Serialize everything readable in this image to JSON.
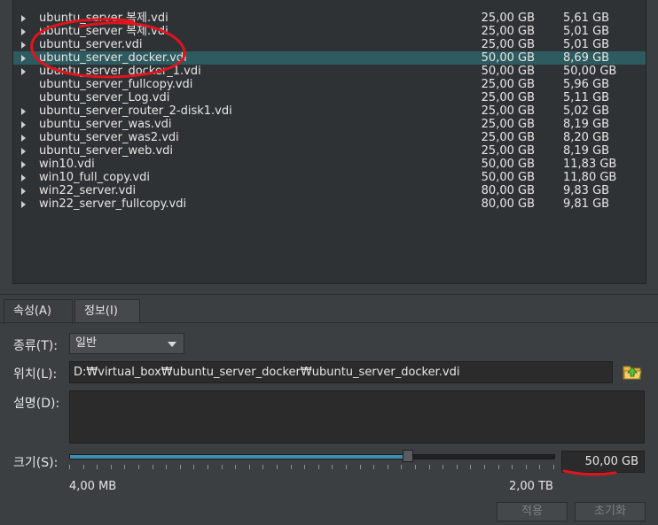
{
  "disk_list": {
    "rows": [
      {
        "name": "ubuntu_server 복제.vdi",
        "has_children": true,
        "selected": false,
        "virtual_size": "25,00 GB",
        "actual_size": "5,61 GB"
      },
      {
        "name": "ubuntu_server 복제.vdi",
        "has_children": true,
        "selected": false,
        "virtual_size": "25,00 GB",
        "actual_size": "5,01 GB"
      },
      {
        "name": "ubuntu_server.vdi",
        "has_children": true,
        "selected": false,
        "virtual_size": "25,00 GB",
        "actual_size": "5,01 GB"
      },
      {
        "name": "ubuntu_server_docker.vdi",
        "has_children": true,
        "selected": true,
        "virtual_size": "50,00 GB",
        "actual_size": "8,69 GB"
      },
      {
        "name": "ubuntu_server_docker_1.vdi",
        "has_children": true,
        "selected": false,
        "virtual_size": "50,00 GB",
        "actual_size": "50,00 GB"
      },
      {
        "name": "ubuntu_server_fullcopy.vdi",
        "has_children": false,
        "selected": false,
        "virtual_size": "25,00 GB",
        "actual_size": "5,96 GB"
      },
      {
        "name": "ubuntu_server_Log.vdi",
        "has_children": false,
        "selected": false,
        "virtual_size": "25,00 GB",
        "actual_size": "5,11 GB"
      },
      {
        "name": "ubuntu_server_router_2-disk1.vdi",
        "has_children": true,
        "selected": false,
        "virtual_size": "25,00 GB",
        "actual_size": "5,02 GB"
      },
      {
        "name": "ubuntu_server_was.vdi",
        "has_children": true,
        "selected": false,
        "virtual_size": "25,00 GB",
        "actual_size": "8,19 GB"
      },
      {
        "name": "ubuntu_server_was2.vdi",
        "has_children": true,
        "selected": false,
        "virtual_size": "25,00 GB",
        "actual_size": "8,20 GB"
      },
      {
        "name": "ubuntu_server_web.vdi",
        "has_children": true,
        "selected": false,
        "virtual_size": "25,00 GB",
        "actual_size": "8,19 GB"
      },
      {
        "name": "win10.vdi",
        "has_children": true,
        "selected": false,
        "virtual_size": "50,00 GB",
        "actual_size": "11,83 GB"
      },
      {
        "name": "win10_full_copy.vdi",
        "has_children": true,
        "selected": false,
        "virtual_size": "50,00 GB",
        "actual_size": "11,80 GB"
      },
      {
        "name": "win22_server.vdi",
        "has_children": true,
        "selected": false,
        "virtual_size": "80,00 GB",
        "actual_size": "9,83 GB"
      },
      {
        "name": "win22_server_fullcopy.vdi",
        "has_children": true,
        "selected": false,
        "virtual_size": "80,00 GB",
        "actual_size": "9,81 GB"
      }
    ]
  },
  "tabs": {
    "attributes": "속성(A)",
    "information": "정보(I)"
  },
  "form": {
    "type_label": "종류(T):",
    "type_value": "일반",
    "location_label": "위치(L):",
    "location_value": "D:₩virtual_box₩ubuntu_server_docker₩ubuntu_server_docker.vdi",
    "description_label": "설명(D):",
    "description_value": "",
    "size_label": "크기(S):",
    "size_value": "50,00 GB",
    "size_min": "4,00 MB",
    "size_max": "2,00 TB",
    "size_slider_fraction": 0.7
  },
  "buttons": {
    "apply": "적용",
    "reset": "초기화"
  },
  "colors": {
    "selected_row": "#2e5b60",
    "slider_fill": "#3a8fb0",
    "annotation_red": "#e0141e"
  },
  "icons": {
    "folder": "folder-open-icon",
    "expand": "expand-arrow-icon",
    "dropdown": "chevron-down-icon"
  }
}
